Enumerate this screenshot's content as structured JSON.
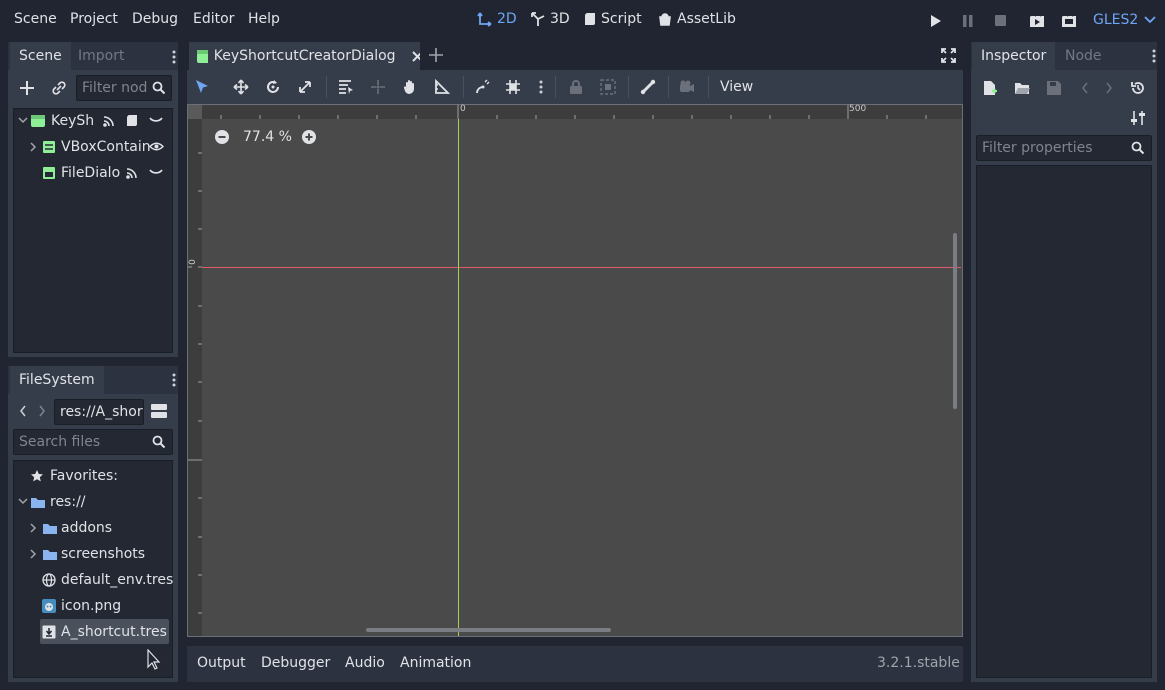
{
  "menu": {
    "scene": "Scene",
    "project": "Project",
    "debug": "Debug",
    "editor": "Editor",
    "help": "Help"
  },
  "workspaces": {
    "twod": "2D",
    "threed": "3D",
    "script": "Script",
    "assetlib": "AssetLib"
  },
  "renderer": "GLES2",
  "scene_dock": {
    "tab_scene": "Scene",
    "tab_import": "Import",
    "filter_placeholder": "Filter nod",
    "nodes": [
      {
        "label": "KeySh"
      },
      {
        "label": "VBoxContain"
      },
      {
        "label": "FileDialo"
      }
    ]
  },
  "filesystem": {
    "tab": "FileSystem",
    "path": "res://A_shor",
    "search_placeholder": "Search files",
    "items": [
      {
        "label": "Favorites:"
      },
      {
        "label": "res://"
      },
      {
        "label": "addons"
      },
      {
        "label": "screenshots"
      },
      {
        "label": "default_env.tres"
      },
      {
        "label": "icon.png"
      },
      {
        "label": "A_shortcut.tres"
      }
    ]
  },
  "editor": {
    "tab_title": "KeyShortcutCreatorDialog",
    "view_menu": "View",
    "zoom": "77.4 %",
    "ruler_labels": [
      "0",
      "500"
    ],
    "ruler_v_label": "0"
  },
  "bottom_panel": {
    "output": "Output",
    "debugger": "Debugger",
    "audio": "Audio",
    "animation": "Animation",
    "version": "3.2.1.stable"
  },
  "inspector": {
    "tab_inspector": "Inspector",
    "tab_node": "Node",
    "filter_placeholder": "Filter properties"
  },
  "colors": {
    "accent": "#6ea6f5",
    "background": "#202531",
    "panel": "#2c3240",
    "viewport": "#4a4a4a",
    "node_green": "#8eef97"
  }
}
